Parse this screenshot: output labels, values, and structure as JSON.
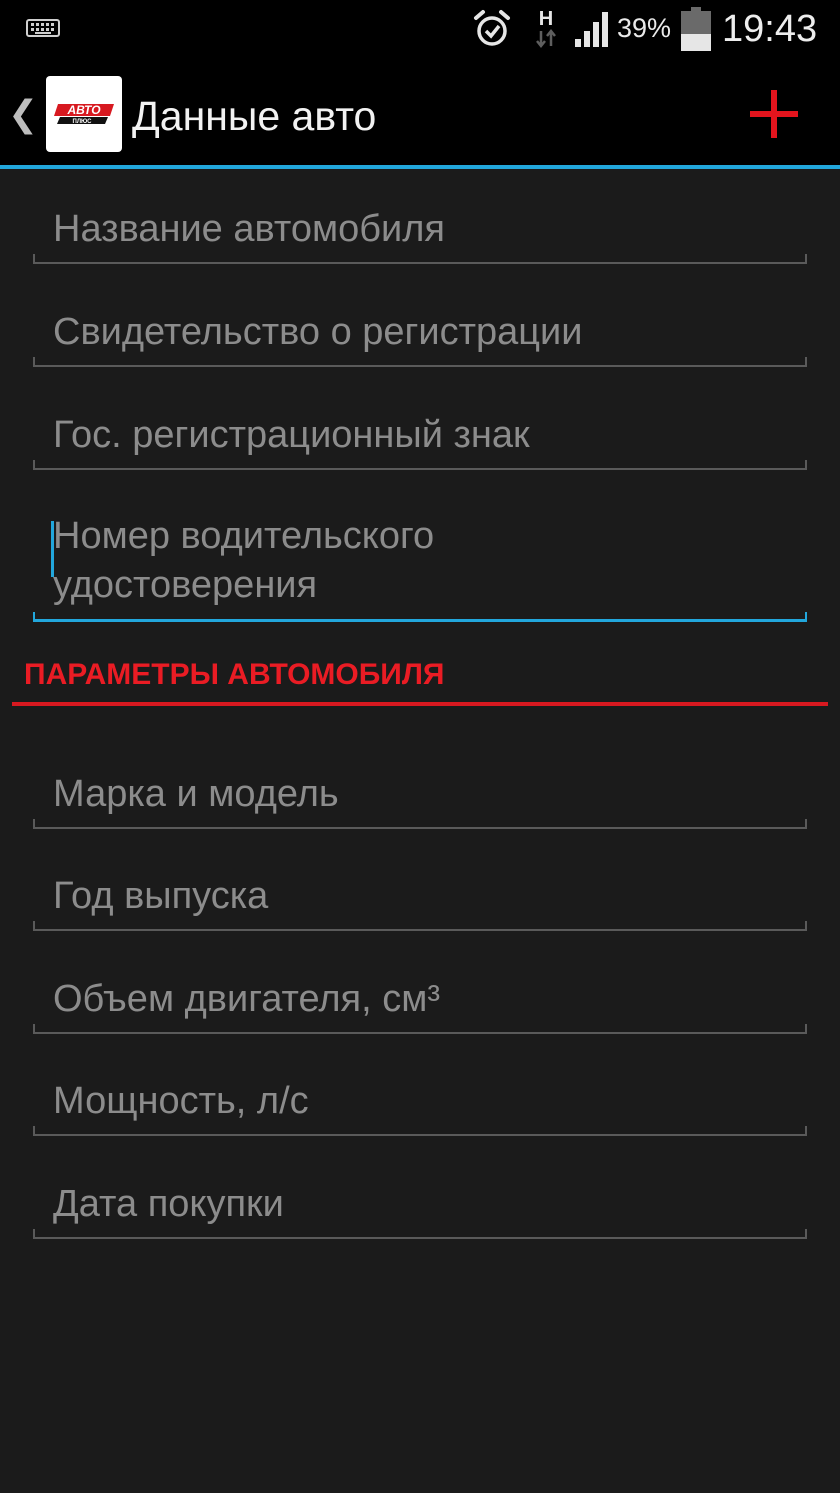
{
  "status_bar": {
    "network_type": "H",
    "battery_percent": "39%",
    "time": "19:43",
    "icons": [
      "keyboard-icon",
      "alarm-icon",
      "network-h-icon",
      "signal-icon",
      "battery-icon"
    ]
  },
  "action_bar": {
    "title": "Данные авто",
    "logo_text": "АВТО ПЛЮС",
    "add_icon": "plus-icon"
  },
  "fields_group1": [
    {
      "placeholder": "Название автомобиля"
    },
    {
      "placeholder": "Свидетельство о регистрации"
    },
    {
      "placeholder": "Гос. регистрационный знак"
    },
    {
      "placeholder_line1": "Номер водительского",
      "placeholder_line2": "удостоверения",
      "focused": true
    }
  ],
  "section": {
    "title": "ПАРАМЕТРЫ АВТОМОБИЛЯ"
  },
  "fields_group2": [
    {
      "placeholder": "Марка и модель"
    },
    {
      "placeholder": "Год выпуска"
    },
    {
      "placeholder": "Объем двигателя, см³"
    },
    {
      "placeholder": "Мощность, л/с"
    },
    {
      "placeholder": "Дата покупки"
    }
  ],
  "colors": {
    "accent_blue": "#22a7dc",
    "accent_red": "#ea1c24",
    "background": "#1b1b1b",
    "hint_text": "#8c8c8c"
  }
}
